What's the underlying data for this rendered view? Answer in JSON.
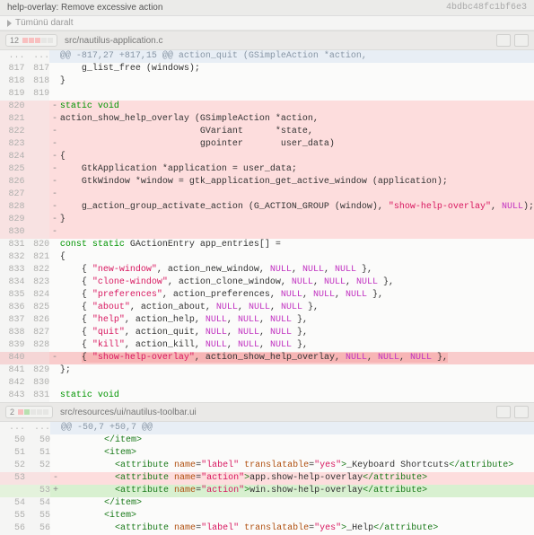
{
  "header": {
    "title": "help-overlay: Remove excessive action",
    "collapse_label": "Tümünü daralt",
    "commit_hash": "4bdbc48fc1bf6e3"
  },
  "files": [
    {
      "count": "12",
      "del_squares": 3,
      "add_squares": 0,
      "neu_squares": 2,
      "path": "src/nautilus-application.c"
    },
    {
      "count": "2",
      "del_squares": 1,
      "add_squares": 1,
      "neu_squares": 3,
      "path": "src/resources/ui/nautilus-toolbar.ui"
    }
  ],
  "diff1": {
    "hunk": "@@ -817,27 +817,15 @@ action_quit (GSimpleAction *action,",
    "rows": [
      {
        "t": "ctx",
        "l": "817",
        "r": "817",
        "s": " ",
        "c": "    g_list_free (windows);"
      },
      {
        "t": "ctx",
        "l": "818",
        "r": "818",
        "s": " ",
        "c": "}"
      },
      {
        "t": "ctx",
        "l": "819",
        "r": "819",
        "s": " ",
        "c": ""
      },
      {
        "t": "del",
        "l": "820",
        "r": "",
        "s": "-",
        "c": "static void",
        "kw": true
      },
      {
        "t": "del",
        "l": "821",
        "r": "",
        "s": "-",
        "c": "action_show_help_overlay (GSimpleAction *action,"
      },
      {
        "t": "del",
        "l": "822",
        "r": "",
        "s": "-",
        "c": "                          GVariant      *state,"
      },
      {
        "t": "del",
        "l": "823",
        "r": "",
        "s": "-",
        "c": "                          gpointer       user_data)"
      },
      {
        "t": "del",
        "l": "824",
        "r": "",
        "s": "-",
        "c": "{"
      },
      {
        "t": "del",
        "l": "825",
        "r": "",
        "s": "-",
        "c": "    GtkApplication *application = user_data;"
      },
      {
        "t": "del",
        "l": "826",
        "r": "",
        "s": "-",
        "c": "    GtkWindow *window = gtk_application_get_active_window (application);"
      },
      {
        "t": "del",
        "l": "827",
        "r": "",
        "s": "-",
        "c": ""
      },
      {
        "t": "del",
        "l": "828",
        "r": "",
        "s": "-",
        "c_html": "    g_action_group_activate_action (G_ACTION_GROUP (window), <span class=\"str\">\"show-help-overlay\"</span>, <span class=\"null\">NULL</span>);"
      },
      {
        "t": "del",
        "l": "829",
        "r": "",
        "s": "-",
        "c": "}"
      },
      {
        "t": "del",
        "l": "830",
        "r": "",
        "s": "-",
        "c": ""
      },
      {
        "t": "ctx",
        "l": "831",
        "r": "820",
        "s": " ",
        "c_html": "<span class=\"kw\">const static</span> GActionEntry app_entries[] ="
      },
      {
        "t": "ctx",
        "l": "832",
        "r": "821",
        "s": " ",
        "c": "{"
      },
      {
        "t": "ctx",
        "l": "833",
        "r": "822",
        "s": " ",
        "c_html": "    { <span class=\"str\">\"new-window\"</span>, action_new_window, <span class=\"null\">NULL</span>, <span class=\"null\">NULL</span>, <span class=\"null\">NULL</span> },"
      },
      {
        "t": "ctx",
        "l": "834",
        "r": "823",
        "s": " ",
        "c_html": "    { <span class=\"str\">\"clone-window\"</span>, action_clone_window, <span class=\"null\">NULL</span>, <span class=\"null\">NULL</span>, <span class=\"null\">NULL</span> },"
      },
      {
        "t": "ctx",
        "l": "835",
        "r": "824",
        "s": " ",
        "c_html": "    { <span class=\"str\">\"preferences\"</span>, action_preferences, <span class=\"null\">NULL</span>, <span class=\"null\">NULL</span>, <span class=\"null\">NULL</span> },"
      },
      {
        "t": "ctx",
        "l": "836",
        "r": "825",
        "s": " ",
        "c_html": "    { <span class=\"str\">\"about\"</span>, action_about, <span class=\"null\">NULL</span>, <span class=\"null\">NULL</span>, <span class=\"null\">NULL</span> },"
      },
      {
        "t": "ctx",
        "l": "837",
        "r": "826",
        "s": " ",
        "c_html": "    { <span class=\"str\">\"help\"</span>, action_help, <span class=\"null\">NULL</span>, <span class=\"null\">NULL</span>, <span class=\"null\">NULL</span> },"
      },
      {
        "t": "ctx",
        "l": "838",
        "r": "827",
        "s": " ",
        "c_html": "    { <span class=\"str\">\"quit\"</span>, action_quit, <span class=\"null\">NULL</span>, <span class=\"null\">NULL</span>, <span class=\"null\">NULL</span> },"
      },
      {
        "t": "ctx",
        "l": "839",
        "r": "828",
        "s": " ",
        "c_html": "    { <span class=\"str\">\"kill\"</span>, action_kill, <span class=\"null\">NULL</span>, <span class=\"null\">NULL</span>, <span class=\"null\">NULL</span> },"
      },
      {
        "t": "del-strong",
        "l": "840",
        "r": "",
        "s": "-",
        "c_html": "    <span class=\"hl-del\">{ <span class=\"str\">\"show-help-overlay\"</span>, action_show_help_overlay, <span class=\"null\">NULL</span>, <span class=\"null\">NULL</span>, <span class=\"null\">NULL</span> },</span>"
      },
      {
        "t": "ctx",
        "l": "841",
        "r": "829",
        "s": " ",
        "c": "};"
      },
      {
        "t": "ctx",
        "l": "842",
        "r": "830",
        "s": " ",
        "c": ""
      },
      {
        "t": "ctx",
        "l": "843",
        "r": "831",
        "s": " ",
        "c_html": "<span class=\"kw\">static void</span>"
      }
    ]
  },
  "diff2": {
    "hunk": "@@ -50,7 +50,7 @@",
    "rows": [
      {
        "t": "ctx",
        "l": "50",
        "r": "50",
        "s": " ",
        "c_html": "        <span class=\"tag\">&lt;/item&gt;</span>"
      },
      {
        "t": "ctx",
        "l": "51",
        "r": "51",
        "s": " ",
        "c_html": "        <span class=\"tag\">&lt;item&gt;</span>"
      },
      {
        "t": "ctx",
        "l": "52",
        "r": "52",
        "s": " ",
        "c_html": "          <span class=\"tag\">&lt;attribute</span> <span class=\"attrn\">name</span>=<span class=\"attrv\">\"label\"</span> <span class=\"attrn\">translatable</span>=<span class=\"attrv\">\"yes\"</span><span class=\"tag\">&gt;</span>_Keyboard Shortcuts<span class=\"tag\">&lt;/attribute&gt;</span>"
      },
      {
        "t": "del",
        "l": "53",
        "r": "",
        "s": "-",
        "c_html": "          <span class=\"tag\">&lt;attribute</span> <span class=\"attrn\">name</span>=<span class=\"attrv\">\"action\"</span><span class=\"tag\">&gt;</span>app.show-help-overlay<span class=\"tag\">&lt;/attribute&gt;</span>"
      },
      {
        "t": "add",
        "l": "",
        "r": "53",
        "s": "+",
        "c_html": "          <span class=\"tag\">&lt;attribute</span> <span class=\"attrn\">name</span>=<span class=\"attrv\">\"action\"</span><span class=\"tag\">&gt;</span>win.show-help-overlay<span class=\"tag\">&lt;/attribute&gt;</span>"
      },
      {
        "t": "ctx",
        "l": "54",
        "r": "54",
        "s": " ",
        "c_html": "        <span class=\"tag\">&lt;/item&gt;</span>"
      },
      {
        "t": "ctx",
        "l": "55",
        "r": "55",
        "s": " ",
        "c_html": "        <span class=\"tag\">&lt;item&gt;</span>"
      },
      {
        "t": "ctx",
        "l": "56",
        "r": "56",
        "s": " ",
        "c_html": "          <span class=\"tag\">&lt;attribute</span> <span class=\"attrn\">name</span>=<span class=\"attrv\">\"label\"</span> <span class=\"attrn\">translatable</span>=<span class=\"attrv\">\"yes\"</span><span class=\"tag\">&gt;</span>_Help<span class=\"tag\">&lt;/attribute&gt;</span>"
      }
    ]
  },
  "dots": "..."
}
